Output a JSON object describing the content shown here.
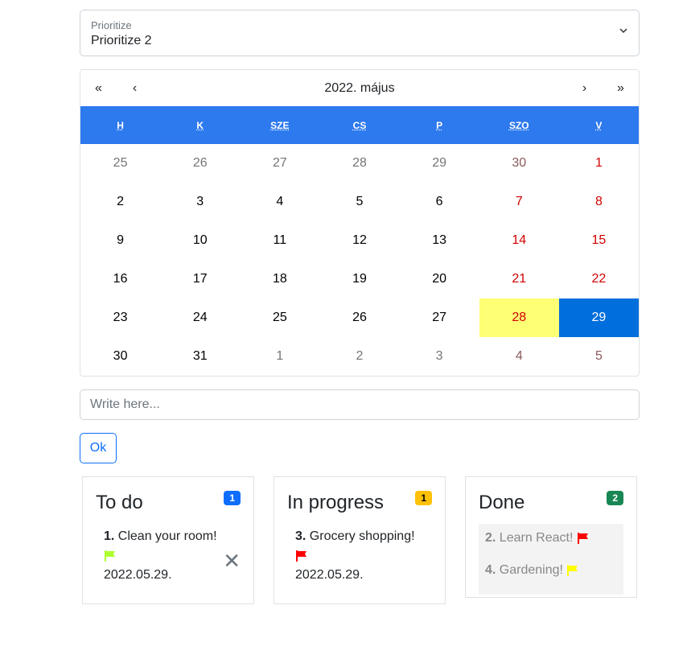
{
  "priority_select": {
    "label": "Prioritize",
    "value": "Prioritize 2"
  },
  "calendar": {
    "prev2": "«",
    "prev": "‹",
    "title": "2022. május",
    "next": "›",
    "next2": "»",
    "weekdays": [
      "H",
      "K",
      "SZE",
      "CS",
      "P",
      "SZO",
      "V"
    ],
    "days": [
      [
        "25",
        "26",
        "27",
        "28",
        "29",
        "30",
        "1"
      ],
      [
        "2",
        "3",
        "4",
        "5",
        "6",
        "7",
        "8"
      ],
      [
        "9",
        "10",
        "11",
        "12",
        "13",
        "14",
        "15"
      ],
      [
        "16",
        "17",
        "18",
        "19",
        "20",
        "21",
        "22"
      ],
      [
        "23",
        "24",
        "25",
        "26",
        "27",
        "28",
        "29"
      ],
      [
        "30",
        "31",
        "1",
        "2",
        "3",
        "4",
        "5"
      ]
    ],
    "today": "28",
    "selected": "29"
  },
  "input": {
    "placeholder": "Write here...",
    "value": ""
  },
  "ok_label": "Ok",
  "columns": [
    {
      "title": "To do",
      "count": "1",
      "badge_color": "#0d6efd",
      "items": [
        {
          "num": "1.",
          "text": "Clean your room!",
          "flag_color": "#adff2f",
          "date": "2022.05.29."
        }
      ]
    },
    {
      "title": "In progress",
      "count": "1",
      "badge_color": "#ffc107",
      "items": [
        {
          "num": "3.",
          "text": "Grocery shopping!",
          "flag_color": "#ff0000",
          "date": "2022.05.29."
        }
      ]
    },
    {
      "title": "Done",
      "count": "2",
      "badge_color": "#198754",
      "items": [
        {
          "num": "2.",
          "text": "Learn React!",
          "flag_color": "#ff0000"
        },
        {
          "num": "4.",
          "text": "Gardening!",
          "flag_color": "#ffff00"
        }
      ]
    }
  ]
}
